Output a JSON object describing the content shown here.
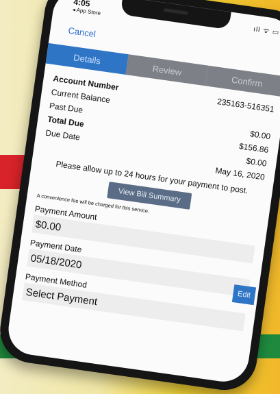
{
  "status_bar": {
    "time": "4:05",
    "back_app": "◂ App Store",
    "icons": "ıll ᯤ ▭"
  },
  "nav": {
    "cancel_label": "Cancel"
  },
  "tabs": [
    {
      "label": "Details"
    },
    {
      "label": "Review"
    },
    {
      "label": "Confirm"
    }
  ],
  "account": {
    "account_number_label": "Account Number",
    "account_number": "235163-516351",
    "current_balance_label": "Current Balance",
    "past_due_label": "Past Due",
    "current_balance": "$0.00",
    "past_due": "$156.86",
    "total_due_label": "Total Due",
    "total_due": "$0.00",
    "due_date_label": "Due Date",
    "due_date": "May 16, 2020"
  },
  "notice": "Please allow up to 24 hours for your payment to post.",
  "view_bill_button": "View Bill Summary",
  "fee_note": "A convenience fee will be charged for this service.",
  "payment_amount": {
    "label": "Payment Amount",
    "value": "$0.00"
  },
  "payment_date": {
    "label": "Payment Date",
    "value": "05/18/2020",
    "edit_label": "Edit"
  },
  "payment_method": {
    "label": "Payment Method",
    "value": "Select Payment"
  },
  "colors": {
    "tab_active": "#2f75c6",
    "tab_inactive": "#7d8087",
    "red_band": "#d8232a",
    "green_band": "#1f8a3e"
  }
}
